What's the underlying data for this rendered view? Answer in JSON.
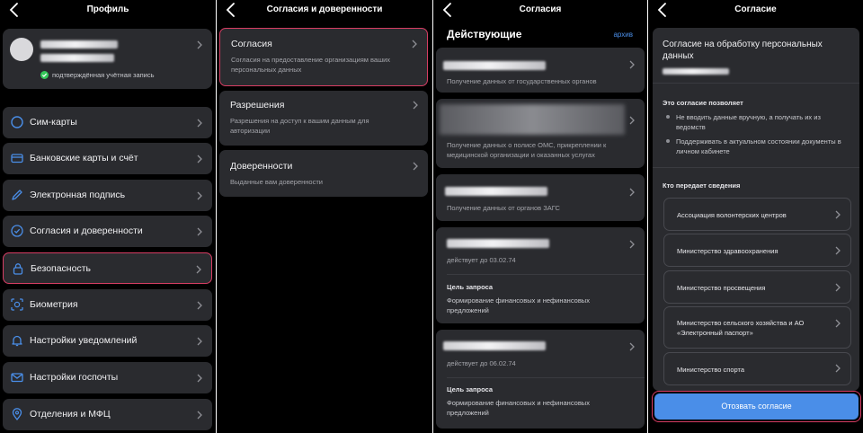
{
  "colors": {
    "background": "#000000",
    "card": "#2a2b2f",
    "accent": "#4a8ee8",
    "selection": "#d63d63",
    "muted_text": "#a4a5ab",
    "verified": "#34c759"
  },
  "screen1": {
    "title": "Профиль",
    "profile": {
      "status": "подтверждённая учётная запись"
    },
    "menu": [
      {
        "label": "Сим-карты",
        "icon": "sim-card-icon"
      },
      {
        "label": "Банковские карты и счёт",
        "icon": "bank-card-icon"
      },
      {
        "label": "Электронная подпись",
        "icon": "pen-icon"
      },
      {
        "label": "Согласия и доверенности",
        "icon": "check-circle-icon"
      },
      {
        "label": "Безопасность",
        "icon": "lock-icon",
        "selected": true
      },
      {
        "label": "Биометрия",
        "icon": "face-scan-icon"
      },
      {
        "label": "Настройки уведомлений",
        "icon": "bell-icon"
      },
      {
        "label": "Настройки госпочты",
        "icon": "mail-icon"
      },
      {
        "label": "Отделения и МФЦ",
        "icon": "location-pin-icon"
      }
    ]
  },
  "screen2": {
    "title": "Согласия и доверенности",
    "cards": [
      {
        "label": "Согласия",
        "desc": "Согласия на предоставление организациям ваших персональных данных",
        "selected": true
      },
      {
        "label": "Разрешения",
        "desc": "Разрешения на доступ к вашим данным для авторизации"
      },
      {
        "label": "Доверенности",
        "desc": "Выданные вам доверенности"
      }
    ]
  },
  "screen3": {
    "title": "Согласия",
    "heading": "Действующие",
    "archive": "архив",
    "items": [
      {
        "desc": "Получение данных от государственных органов"
      },
      {
        "desc": "Получение данных о полисе ОМС, прикреплении к медицинской организации и оказанных услугах"
      },
      {
        "desc": "Получение данных от органов ЗАГС"
      },
      {
        "valid": "действует до 03.02.74",
        "goal_label": "Цель запроса",
        "goal": "Формирование финансовых и нефинансовых предложений"
      },
      {
        "valid": "действует до 06.02.74",
        "goal_label": "Цель запроса",
        "goal": "Формирование финансовых и нефинансовых предложений"
      }
    ]
  },
  "screen4": {
    "title": "Согласие",
    "heading": "Согласие на обработку персональных данных",
    "allows_label": "Это согласие позволяет",
    "bullets": [
      "Не вводить данные вручную, а получать их из ведомств",
      "Поддерживать в актуальном состоянии документы в личном кабинете"
    ],
    "providers_label": "Кто передает сведения",
    "providers": [
      "Ассоциация волонтерских центров",
      "Министерство здравоохранения",
      "Министерство просвещения",
      "Министерство сельского хозяйства и АО «Электронный паспорт»",
      "Министерство спорта"
    ],
    "revoke": "Отозвать согласие"
  }
}
